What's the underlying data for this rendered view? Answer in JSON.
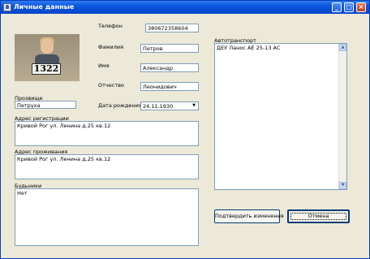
{
  "window": {
    "title": "Личные данные",
    "controls": {
      "minimize": "_",
      "maximize": "□",
      "close": "×"
    }
  },
  "photo": {
    "plate_number": "1322"
  },
  "fields": {
    "phone": {
      "label": "Телефон",
      "value": "380672358604"
    },
    "surname": {
      "label": "Фамилия",
      "value": "Петров"
    },
    "name": {
      "label": "Имя",
      "value": "Александр"
    },
    "patronymic": {
      "label": "Отчество",
      "value": "Леонидович"
    },
    "birth_date": {
      "label": "Дата рождения",
      "value": "24.11.1930"
    },
    "nickname": {
      "label": "Прозвище",
      "value": "Петруха"
    },
    "registration_address": {
      "label": "Адрес регистрации",
      "value": "Кривой Рог ул. Ленина д.25 кв.12"
    },
    "residence_address": {
      "label": "Адрес проживания",
      "value": "Кривой Рог ул. Ленина д.25 кв.12"
    },
    "accomplices": {
      "label": "Будьники",
      "value": "Нет"
    },
    "vehicle": {
      "label": "Автотранспорт",
      "value": "ДЕУ Ланос AE 25-13 AC"
    }
  },
  "buttons": {
    "save": "Подтвердить изменения",
    "cancel": "Отмена"
  },
  "icons": {
    "scroll_up": "▲",
    "scroll_down": "▼",
    "dropdown": "▼"
  }
}
